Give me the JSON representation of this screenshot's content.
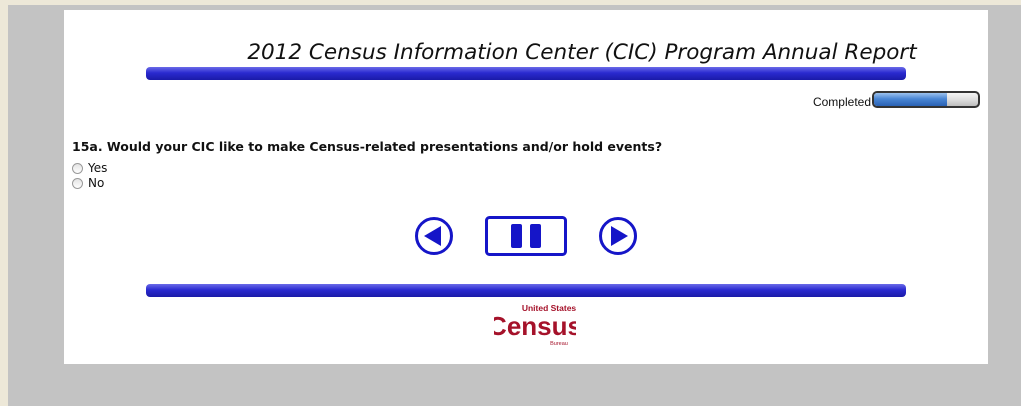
{
  "page": {
    "title": "2012 Census Information Center (CIC) Program Annual Report"
  },
  "progress": {
    "label": "Completed",
    "fraction": 0.7
  },
  "question": {
    "text": "15a. Would your CIC like to make Census-related presentations and/or hold events?",
    "options": [
      {
        "label": "Yes",
        "selected": false
      },
      {
        "label": "No",
        "selected": false
      }
    ]
  },
  "navigation": {
    "prev_icon": "circle-left-arrow-icon",
    "pause_icon": "pause-icon",
    "next_icon": "circle-right-arrow-icon"
  },
  "logo": {
    "top_text": "United States",
    "main_text": "Census",
    "bottom_text": "Bureau"
  },
  "colors": {
    "background": "#ede8d8",
    "frame": "#c3c3c3",
    "panel": "#ffffff",
    "bar_blue": "#2a2ad0",
    "nav_blue": "#1515c8",
    "logo_red": "#a5122a"
  }
}
